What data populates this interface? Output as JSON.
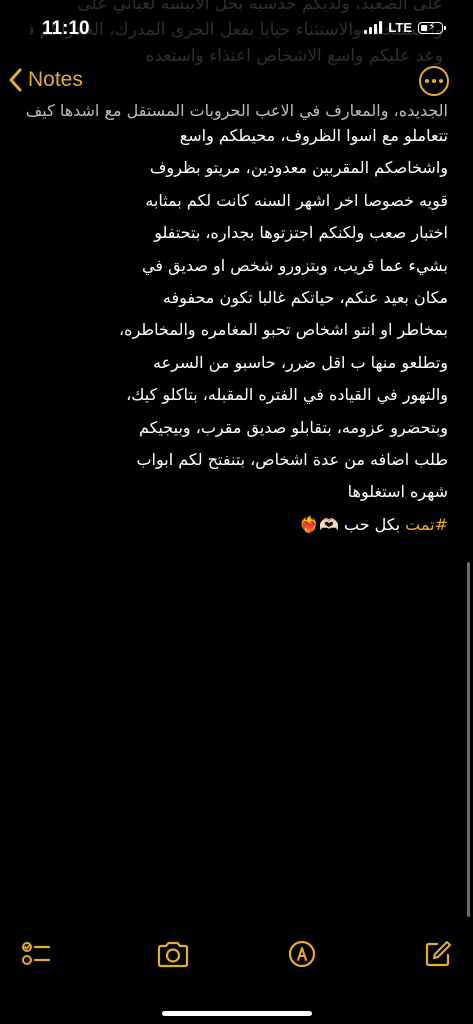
{
  "status_bar": {
    "time": "11:10",
    "network": "LTE",
    "battery_level": 0.35,
    "ghost_lines": [
      "على الصعيد، ولديكم حدسيه بحل الابيسه لعياني على",
      "والاستنجاد، والاستثناء حيايا بفعل الحرى المدرك، الحدرلكم فالفاط",
      "وعد عليكم واسع الاشخاص اعتذاء واستعده"
    ]
  },
  "nav": {
    "back_label": "Notes",
    "accent_color": "#e5ad2b"
  },
  "note": {
    "partial_top_line": "الجديده، والمعارف في الاعب الحروبات المستقل مع اشدها كيف",
    "lines": [
      "تتعاملو مع اسوا الظروف، محيطكم واسع",
      "واشخاصكم المقربين معدودين، مريتو بظروف",
      "قويه خصوصا اخر اشهر السنه كانت لكم بمثابه",
      "اختبار صعب ولكنكم اجتزتوها بجداره، بتحتفلو",
      "بشيء عما قريب، وبتزورو شخص او صديق في",
      "مكان بعيد عنكم، حياتكم غالبا تكون محفوفه",
      "بمخاطر او انتو اشخاص تحبو المغامره والمخاطره،",
      "وتطلعو منها ب اقل ضرر، حاسبو من السرعه",
      "والتهور في القياده في الفتره المقبله، بتاكلو كيك،",
      "وبتحضرو عزومه، بتقابلو صديق مقرب، وبيجيكم",
      "طلب اضافه من عدة اشخاص، بتنفتح لكم ابواب",
      "شهره استغلوها"
    ],
    "closing": {
      "hashtag": "#تمت",
      "text": " بكل حب ",
      "emojis": "🫶🏻❤️‍🔥"
    }
  },
  "toolbar": {
    "icons": [
      "checklist-icon",
      "camera-icon",
      "markup-icon",
      "compose-icon"
    ]
  }
}
